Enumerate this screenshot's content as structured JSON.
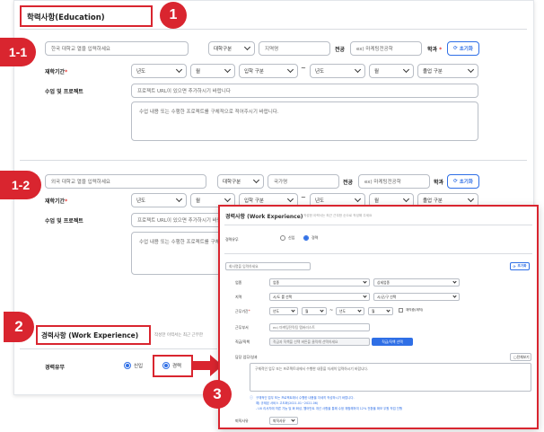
{
  "education": {
    "title": "학력사항(Education)",
    "school1": {
      "school_placeholder": "한국 대학교 열을 입력하세요",
      "type_select": "대학구분",
      "region_placeholder": "지역명",
      "major_label": "전공",
      "major_placeholder": "ex) 마케팅전공학",
      "dept_label": "학과",
      "reset": "초기화",
      "period_label": "재학기간",
      "year": "년도",
      "month": "월",
      "admission": "입학 구분",
      "graduation": "졸업 구분",
      "project_label": "수업 및 프로젝트",
      "url_placeholder": "프로젝트 URL이 있으면 추가하시기 바랍니다",
      "desc_placeholder": "수업 내용 또는 수행한 프로젝트를 구체적으로 적어주시기 바랍니다."
    },
    "school2": {
      "school_placeholder": "외국 대학교 열을 입력하세요",
      "type_select": "대학구분",
      "country_placeholder": "국가명",
      "major_label": "전공",
      "major_placeholder": "ex) 마케팅전공학",
      "dept_label": "학과",
      "reset": "초기화",
      "period_label": "재학기간",
      "year": "년도",
      "month": "월",
      "admission": "입학 구분",
      "graduation": "졸업 구분",
      "project_label": "수업 및 프로젝트",
      "url_placeholder": "프로젝트 URL이 있으면 추가하시기 바랍니다",
      "desc_placeholder": "수업 내용 또는 수행한 프로젝트를 구체적"
    }
  },
  "work": {
    "title": "경력사항 (Work Experience)",
    "subtitle": "작성한 이력서는 최근 근무한",
    "experience_label": "경력유무",
    "radio_new": "신입",
    "radio_experienced": "경력"
  },
  "popup": {
    "title": "경력사항 (Work Experience)",
    "subtitle": "작성한 이력서는 최근 근무한 순으로 작성해 주세요",
    "experience_label": "경력유무",
    "radio_new": "신입",
    "radio_experienced": "경력",
    "company_placeholder": "회사명을 입력하세요",
    "reset": "초기화",
    "industry_label": "업종",
    "industry_value": "업종",
    "industry_detail": "상세업종",
    "location_label": "지역",
    "city_value": "시/도 를 선택",
    "district_value": "시/군/구 선택",
    "period_label": "근무기간",
    "year": "년도",
    "month": "월",
    "currently_working": "재직중(재직)",
    "dept_label": "근무부서",
    "dept_placeholder": "ex) 마케팅전략팀 멤버러스트",
    "rank_label": "직급/직책",
    "rank_placeholder": "직급과 직책을 선택 버튼을 클릭해 선택하세요",
    "rank_button": "직급/직책 선택",
    "duty_label": "담당 업무/성과",
    "example_button": "전체보기",
    "duty_placeholder": "구체적인 업무 또는 프로젝트내에서 수행한 내용을 자세히 입력하시기 바랍니다.",
    "note1": "구체적인 업무 또는 프로젝트에서 수행한 내용을 자세히 작성하시기 바랍니다.",
    "note2": "예) 규제된 서비스 고도화(2021.01~2021.06)",
    "note3": "- UX 리서치에 따른 기능 및 화 화성, 웹어반트 개선 사항을 통해 수정 체험해하여 12% 전환율 확보 우원 작업 진행",
    "leave_label": "퇴직사유",
    "leave_value": "퇴직사유"
  },
  "badges": {
    "b1": "1",
    "b1_1": "1-1",
    "b1_2": "1-2",
    "b2": "2",
    "b3": "3"
  },
  "colors": {
    "accent_red": "#d9252f",
    "accent_blue": "#2f6fe6"
  }
}
